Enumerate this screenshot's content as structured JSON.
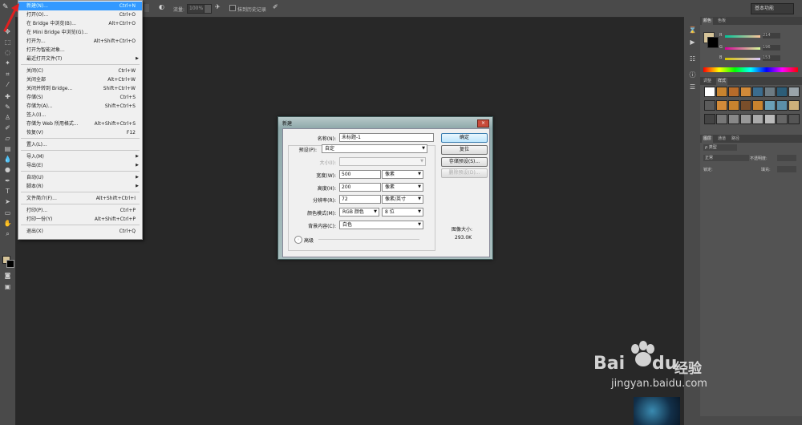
{
  "optionsbar": {
    "flow_label": "流量:",
    "flow_value": "100%",
    "erase_history": "抹到历史记录",
    "workspace": "基本功能"
  },
  "file_menu": {
    "items": [
      {
        "label": "新建(N)...",
        "shortcut": "Ctrl+N",
        "highlighted": true
      },
      {
        "label": "打开(O)...",
        "shortcut": "Ctrl+O"
      },
      {
        "label": "在 Bridge 中浏览(B)...",
        "shortcut": "Alt+Ctrl+O"
      },
      {
        "label": "在 Mini Bridge 中浏览(G)...",
        "shortcut": ""
      },
      {
        "label": "打开为...",
        "shortcut": "Alt+Shift+Ctrl+O"
      },
      {
        "label": "打开为智能对象...",
        "shortcut": ""
      },
      {
        "label": "最近打开文件(T)",
        "shortcut": "",
        "submenu": true
      },
      {
        "label": "关闭(C)",
        "shortcut": "Ctrl+W"
      },
      {
        "label": "关闭全部",
        "shortcut": "Alt+Ctrl+W"
      },
      {
        "label": "关闭并转到 Bridge...",
        "shortcut": "Shift+Ctrl+W"
      },
      {
        "label": "存储(S)",
        "shortcut": "Ctrl+S"
      },
      {
        "label": "存储为(A)...",
        "shortcut": "Shift+Ctrl+S"
      },
      {
        "label": "签入(I)...",
        "shortcut": ""
      },
      {
        "label": "存储为 Web 所用格式...",
        "shortcut": "Alt+Shift+Ctrl+S"
      },
      {
        "label": "恢复(V)",
        "shortcut": "F12"
      },
      {
        "label": "置入(L)...",
        "shortcut": ""
      },
      {
        "label": "导入(M)",
        "shortcut": "",
        "submenu": true
      },
      {
        "label": "导出(E)",
        "shortcut": "",
        "submenu": true
      },
      {
        "label": "自动(U)",
        "shortcut": "",
        "submenu": true
      },
      {
        "label": "脚本(R)",
        "shortcut": "",
        "submenu": true
      },
      {
        "label": "文件简介(F)...",
        "shortcut": "Alt+Shift+Ctrl+I"
      },
      {
        "label": "打印(P)...",
        "shortcut": "Ctrl+P"
      },
      {
        "label": "打印一份(Y)",
        "shortcut": "Alt+Shift+Ctrl+P"
      },
      {
        "label": "退出(X)",
        "shortcut": "Ctrl+Q"
      }
    ]
  },
  "dialog": {
    "title": "新建",
    "close_glyph": "×",
    "name_label": "名称(N):",
    "name_value": "未标题-1",
    "preset_label": "预设(P):",
    "preset_value": "自定",
    "size_label": "大小(I):",
    "width_label": "宽度(W):",
    "width_value": "500",
    "width_unit": "像素",
    "height_label": "高度(H):",
    "height_value": "200",
    "height_unit": "像素",
    "resolution_label": "分辨率(R):",
    "resolution_value": "72",
    "resolution_unit": "像素/英寸",
    "color_mode_label": "颜色模式(M):",
    "color_mode_value": "RGB 颜色",
    "bit_depth_value": "8 位",
    "background_label": "背景内容(C):",
    "background_value": "白色",
    "advanced_label": "高级",
    "ok_label": "确定",
    "reset_label": "复位",
    "save_preset_label": "存储预设(S)...",
    "delete_preset_label": "删除预设(D)...",
    "image_size_label": "图像大小:",
    "image_size_value": "293.0K"
  },
  "right_panel": {
    "color_tab": "颜色",
    "swatches_tab": "色板",
    "r_label": "R",
    "g_label": "G",
    "b_label": "B",
    "r_value": "214",
    "g_value": "196",
    "b_value": "153",
    "adjust_tab": "调整",
    "styles_tab": "样式",
    "layers_tab": "图层",
    "channels_tab": "通道",
    "paths_tab": "路径",
    "kind_label": "ρ 类型",
    "blend_mode": "正常",
    "opacity_label": "不透明度:",
    "lock_label": "锁定:",
    "fill_label": "填充:"
  },
  "watermark": {
    "brand": "Bai",
    "brand2": "du",
    "suffix": "经验",
    "url": "jingyan.baidu.com"
  },
  "colors": {
    "foreground": "#d6c499",
    "background": "#000000",
    "menu_highlight": "#3399ff"
  }
}
